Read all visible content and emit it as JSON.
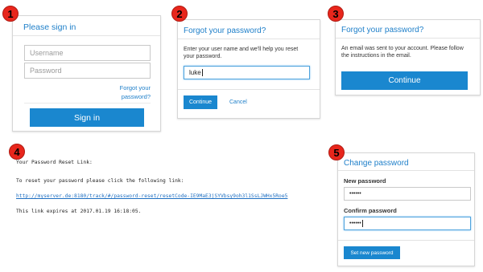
{
  "step1": {
    "badge": "1",
    "title": "Please sign in",
    "username_placeholder": "Username",
    "password_placeholder": "Password",
    "forgot_line1": "Forgot your",
    "forgot_line2": "password?",
    "signin_label": "Sign in"
  },
  "step2": {
    "badge": "2",
    "title": "Forgot your password?",
    "instructions_line1": "Enter your user name and we'll help you reset",
    "instructions_line2": "your password.",
    "username_value": "luke",
    "continue_label": "Continue",
    "cancel_label": "Cancel"
  },
  "step3": {
    "badge": "3",
    "title": "Forgot your password?",
    "message_line1": "An email was sent to your account. Please follow",
    "message_line2": "the instructions in the email.",
    "continue_label": "Continue"
  },
  "step4": {
    "badge": "4",
    "heading": "Your Password Reset Link:",
    "instruction": "To reset your password please click the following link:",
    "link": "http://myserver.de:8180/track/#/password-reset/resetCode-IE9MaE3jSYVbsy9oh3l1SsLJWHx5Roe5",
    "expiry": "This link expires at 2017.01.19 16:18:05."
  },
  "step5": {
    "badge": "5",
    "title": "Change password",
    "new_password_label": "New password",
    "new_password_value": "••••••",
    "confirm_password_label": "Confirm password",
    "confirm_password_value": "••••••",
    "set_label": "Set new password"
  },
  "colors": {
    "accent": "#1a87cf",
    "title_blue": "#1e7fc9",
    "badge_red": "#e8261c"
  }
}
